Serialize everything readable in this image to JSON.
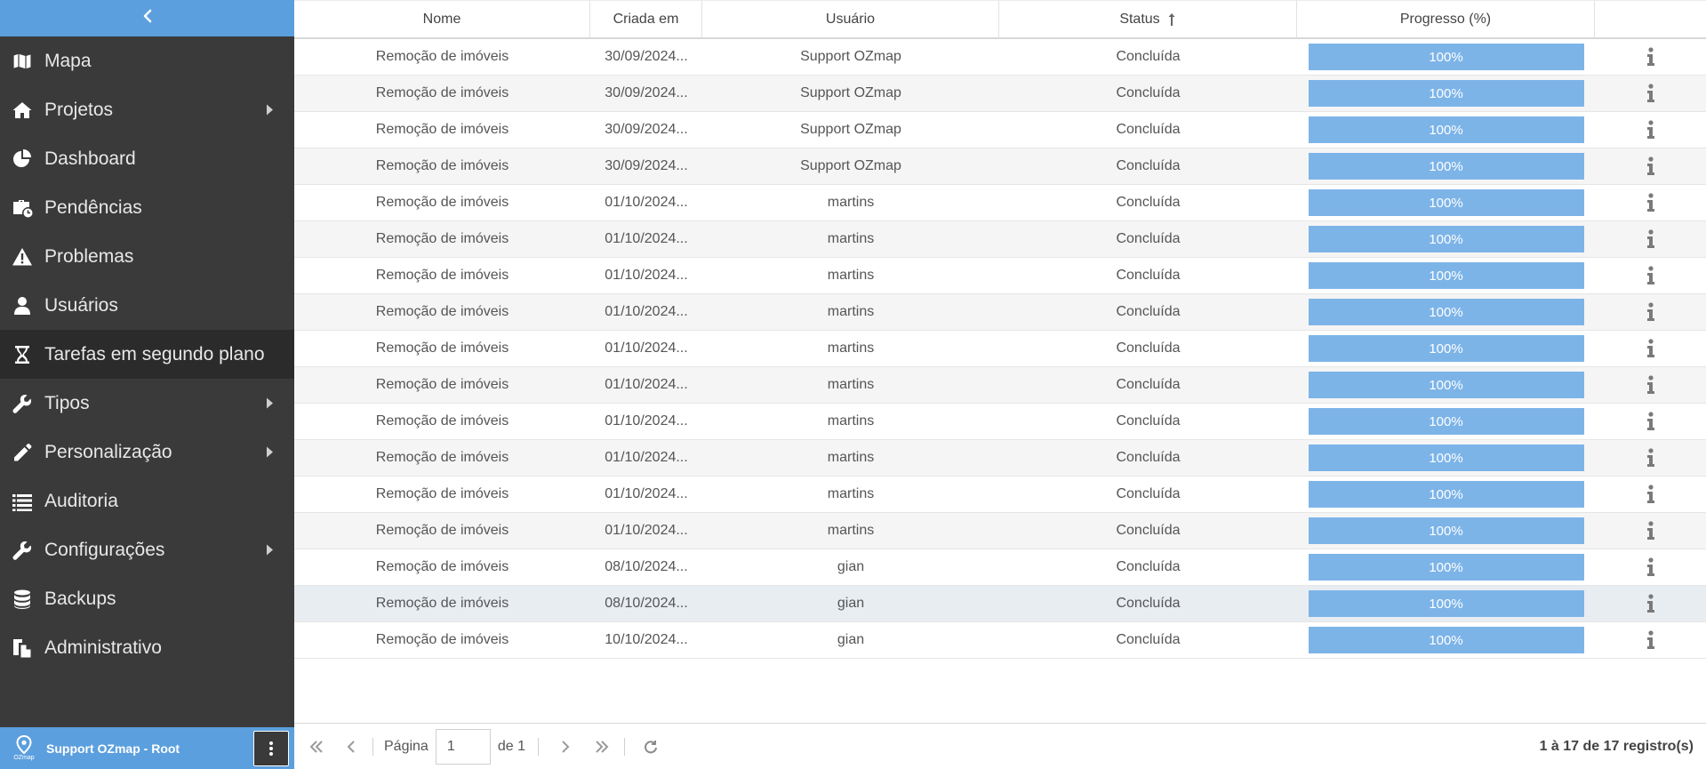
{
  "sidebar": {
    "collapse_icon": "chevron-left-icon",
    "items": [
      {
        "label": "Mapa",
        "icon": "map-icon",
        "has_submenu": false
      },
      {
        "label": "Projetos",
        "icon": "home-icon",
        "has_submenu": true
      },
      {
        "label": "Dashboard",
        "icon": "pie-chart-icon",
        "has_submenu": false
      },
      {
        "label": "Pendências",
        "icon": "briefcase-clock-icon",
        "has_submenu": false
      },
      {
        "label": "Problemas",
        "icon": "warning-icon",
        "has_submenu": false
      },
      {
        "label": "Usuários",
        "icon": "user-icon",
        "has_submenu": false
      },
      {
        "label": "Tarefas em segundo plano",
        "icon": "hourglass-icon",
        "has_submenu": false,
        "active": true
      },
      {
        "label": "Tipos",
        "icon": "wrench-icon",
        "has_submenu": true
      },
      {
        "label": "Personalização",
        "icon": "pencil-icon",
        "has_submenu": true
      },
      {
        "label": "Auditoria",
        "icon": "list-icon",
        "has_submenu": false
      },
      {
        "label": "Configurações",
        "icon": "wrench-icon",
        "has_submenu": true
      },
      {
        "label": "Backups",
        "icon": "database-icon",
        "has_submenu": false
      },
      {
        "label": "Administrativo",
        "icon": "document-copy-icon",
        "has_submenu": false
      }
    ],
    "footer": {
      "logo_text": "OZmap",
      "user": "Support OZmap - Root"
    }
  },
  "grid": {
    "columns": {
      "nome": "Nome",
      "criada_em": "Criada em",
      "usuario": "Usuário",
      "status": "Status",
      "progresso": "Progresso (%)",
      "info": ""
    },
    "sorted_column": "status",
    "sort_direction": "asc",
    "rows": [
      {
        "nome": "Remoção de imóveis",
        "criada_em": "30/09/2024...",
        "usuario": "Support OZmap",
        "status": "Concluída",
        "progresso": "100%",
        "progress_value": 100
      },
      {
        "nome": "Remoção de imóveis",
        "criada_em": "30/09/2024...",
        "usuario": "Support OZmap",
        "status": "Concluída",
        "progresso": "100%",
        "progress_value": 100
      },
      {
        "nome": "Remoção de imóveis",
        "criada_em": "30/09/2024...",
        "usuario": "Support OZmap",
        "status": "Concluída",
        "progresso": "100%",
        "progress_value": 100
      },
      {
        "nome": "Remoção de imóveis",
        "criada_em": "30/09/2024...",
        "usuario": "Support OZmap",
        "status": "Concluída",
        "progresso": "100%",
        "progress_value": 100
      },
      {
        "nome": "Remoção de imóveis",
        "criada_em": "01/10/2024...",
        "usuario": "martins",
        "status": "Concluída",
        "progresso": "100%",
        "progress_value": 100
      },
      {
        "nome": "Remoção de imóveis",
        "criada_em": "01/10/2024...",
        "usuario": "martins",
        "status": "Concluída",
        "progresso": "100%",
        "progress_value": 100
      },
      {
        "nome": "Remoção de imóveis",
        "criada_em": "01/10/2024...",
        "usuario": "martins",
        "status": "Concluída",
        "progresso": "100%",
        "progress_value": 100
      },
      {
        "nome": "Remoção de imóveis",
        "criada_em": "01/10/2024...",
        "usuario": "martins",
        "status": "Concluída",
        "progresso": "100%",
        "progress_value": 100
      },
      {
        "nome": "Remoção de imóveis",
        "criada_em": "01/10/2024...",
        "usuario": "martins",
        "status": "Concluída",
        "progresso": "100%",
        "progress_value": 100
      },
      {
        "nome": "Remoção de imóveis",
        "criada_em": "01/10/2024...",
        "usuario": "martins",
        "status": "Concluída",
        "progresso": "100%",
        "progress_value": 100
      },
      {
        "nome": "Remoção de imóveis",
        "criada_em": "01/10/2024...",
        "usuario": "martins",
        "status": "Concluída",
        "progresso": "100%",
        "progress_value": 100
      },
      {
        "nome": "Remoção de imóveis",
        "criada_em": "01/10/2024...",
        "usuario": "martins",
        "status": "Concluída",
        "progresso": "100%",
        "progress_value": 100
      },
      {
        "nome": "Remoção de imóveis",
        "criada_em": "01/10/2024...",
        "usuario": "martins",
        "status": "Concluída",
        "progresso": "100%",
        "progress_value": 100
      },
      {
        "nome": "Remoção de imóveis",
        "criada_em": "01/10/2024...",
        "usuario": "martins",
        "status": "Concluída",
        "progresso": "100%",
        "progress_value": 100
      },
      {
        "nome": "Remoção de imóveis",
        "criada_em": "08/10/2024...",
        "usuario": "gian",
        "status": "Concluída",
        "progresso": "100%",
        "progress_value": 100
      },
      {
        "nome": "Remoção de imóveis",
        "criada_em": "08/10/2024...",
        "usuario": "gian",
        "status": "Concluída",
        "progresso": "100%",
        "progress_value": 100,
        "selected": true
      },
      {
        "nome": "Remoção de imóveis",
        "criada_em": "10/10/2024...",
        "usuario": "gian",
        "status": "Concluída",
        "progresso": "100%",
        "progress_value": 100
      }
    ]
  },
  "pager": {
    "page_label": "Página",
    "page_value": "1",
    "of_label": "de 1",
    "status": "1 à 17 de 17 registro(s)"
  },
  "colors": {
    "accent": "#5b9fde",
    "sidebar_bg": "#3a3a3a",
    "progress_bar": "#7db4e8"
  }
}
